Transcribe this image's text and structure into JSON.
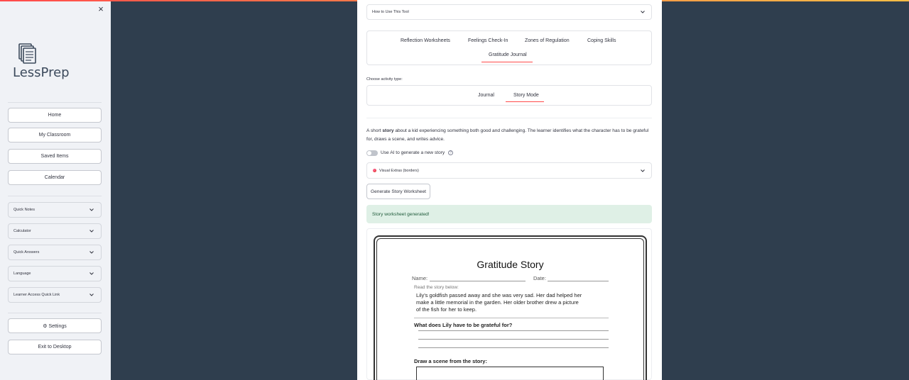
{
  "sidebar": {
    "close_glyph": "×",
    "logo_text": "LessPrep",
    "nav": [
      "Home",
      "My Classroom",
      "Saved Items",
      "Calendar"
    ],
    "expanders": [
      "Quick Notes",
      "Calculator",
      "Quick Answers",
      "Language",
      "Learner Access Quick Link"
    ],
    "settings_label": "⚙ Settings",
    "exit_label": "Exit to Desktop"
  },
  "main": {
    "how_to": "How to Use This Tool",
    "tabs": [
      "Reflection Worksheets",
      "Feelings Check-In",
      "Zones of Regulation",
      "Coping Skills",
      "Gratitude Journal"
    ],
    "active_tab": "Gratitude Journal",
    "activity_label": "Choose activity type:",
    "activity_tabs": [
      "Journal",
      "Story Mode"
    ],
    "active_activity": "Story Mode",
    "desc_prefix": "A short ",
    "desc_bold": "story",
    "desc_rest": " about a kid experiencing something both good and challenging. The learner identifies what the character has to be grateful for, draws a scene, and writes advice.",
    "toggle_label": "Use AI to generate a new story",
    "help_glyph": "?",
    "visual_extras": "Visual Extras (borders)",
    "generate_button": "Generate Story Worksheet",
    "success_msg": "Story worksheet generated!"
  },
  "worksheet": {
    "title": "Gratitude Story",
    "name_label": "Name:",
    "date_label": "Date:",
    "read_label": "Read the story below:",
    "story_lines": [
      "Lily's goldfish passed away and she was very sad. Her dad helped her",
      "make a little memorial in the garden. Her older brother drew a picture",
      "of the fish for her to keep."
    ],
    "question": "What does Lily have to be grateful for?",
    "draw_prompt": "Draw a scene from the story:"
  },
  "colors": {
    "accent": "#ff4b4b",
    "background": "#2f3e4e",
    "sidebar": "#f0f2f6",
    "success_bg": "#dff0e6"
  },
  "icons": [
    "close-icon",
    "logo-icon",
    "chevron-down-icon",
    "gear-icon",
    "help-icon",
    "palette-icon"
  ]
}
